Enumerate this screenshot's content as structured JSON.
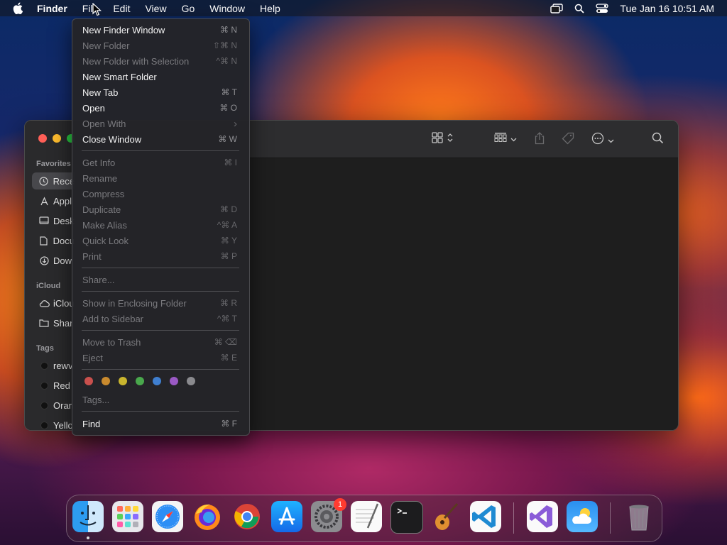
{
  "menubar": {
    "app": "Finder",
    "items": [
      "File",
      "Edit",
      "View",
      "Go",
      "Window",
      "Help"
    ],
    "clock": "Tue Jan 16  10:51 AM",
    "status_icons": [
      "screen-mirroring-icon",
      "search-icon",
      "control-center-icon"
    ]
  },
  "file_menu": {
    "items": [
      {
        "label": "New Finder Window",
        "shortcut": "⌘ N",
        "enabled": true
      },
      {
        "label": "New Folder",
        "shortcut": "⇧⌘ N",
        "enabled": false
      },
      {
        "label": "New Folder with Selection",
        "shortcut": "^⌘ N",
        "enabled": false
      },
      {
        "label": "New Smart Folder",
        "shortcut": "",
        "enabled": true
      },
      {
        "label": "New Tab",
        "shortcut": "⌘ T",
        "enabled": true
      },
      {
        "label": "Open",
        "shortcut": "⌘ O",
        "enabled": true
      },
      {
        "label": "Open With",
        "shortcut": "›",
        "enabled": false
      },
      {
        "label": "Close Window",
        "shortcut": "⌘ W",
        "enabled": true
      },
      {
        "label": "Get Info",
        "shortcut": "⌘ I",
        "enabled": false
      },
      {
        "label": "Rename",
        "shortcut": "",
        "enabled": false
      },
      {
        "label": "Compress",
        "shortcut": "",
        "enabled": false
      },
      {
        "label": "Duplicate",
        "shortcut": "⌘ D",
        "enabled": false
      },
      {
        "label": "Make Alias",
        "shortcut": "^⌘ A",
        "enabled": false
      },
      {
        "label": "Quick Look",
        "shortcut": "⌘ Y",
        "enabled": false
      },
      {
        "label": "Print",
        "shortcut": "⌘ P",
        "enabled": false
      },
      {
        "label": "Share...",
        "shortcut": "",
        "enabled": false
      },
      {
        "label": "Show in Enclosing Folder",
        "shortcut": "⌘ R",
        "enabled": false
      },
      {
        "label": "Add to Sidebar",
        "shortcut": "^⌘ T",
        "enabled": false
      },
      {
        "label": "Move to Trash",
        "shortcut": "⌘ ⌫",
        "enabled": false
      },
      {
        "label": "Eject",
        "shortcut": "⌘ E",
        "enabled": false
      },
      {
        "label": "Tags...",
        "shortcut": "",
        "enabled": false
      },
      {
        "label": "Find",
        "shortcut": "⌘ F",
        "enabled": true
      }
    ],
    "tag_colors": [
      "#c9504d",
      "#c98a2e",
      "#c9b52e",
      "#49a84c",
      "#3f7fd0",
      "#9a59c4",
      "#8a8a8e"
    ]
  },
  "sidebar": {
    "sections": {
      "favorites": "Favorites",
      "icloud": "iCloud",
      "tags": "Tags"
    },
    "favorites": [
      "Rece",
      "Appl",
      "Desk",
      "Docu",
      "Dow"
    ],
    "icloud": [
      "iClou",
      "Shar"
    ],
    "tags": [
      "rewv",
      "Red",
      "Oran",
      "Yello"
    ]
  },
  "dock": {
    "apps": [
      {
        "name": "Finder",
        "icon": "finder-icon"
      },
      {
        "name": "Launchpad",
        "icon": "launchpad-icon"
      },
      {
        "name": "Safari",
        "icon": "safari-icon"
      },
      {
        "name": "Firefox",
        "icon": "firefox-icon"
      },
      {
        "name": "Chrome",
        "icon": "chrome-icon"
      },
      {
        "name": "App Store",
        "icon": "app-store-icon"
      },
      {
        "name": "System Settings",
        "icon": "system-settings-icon",
        "badge": "1"
      },
      {
        "name": "TextEdit",
        "icon": "textedit-icon"
      },
      {
        "name": "Terminal",
        "icon": "terminal-icon"
      },
      {
        "name": "GarageBand",
        "icon": "garageband-icon"
      },
      {
        "name": "Visual Studio Code",
        "icon": "vscode-icon"
      },
      {
        "name": "Visual Studio",
        "icon": "visual-studio-icon"
      },
      {
        "name": "Weather",
        "icon": "weather-icon"
      },
      {
        "name": "Trash",
        "icon": "trash-icon"
      }
    ]
  }
}
